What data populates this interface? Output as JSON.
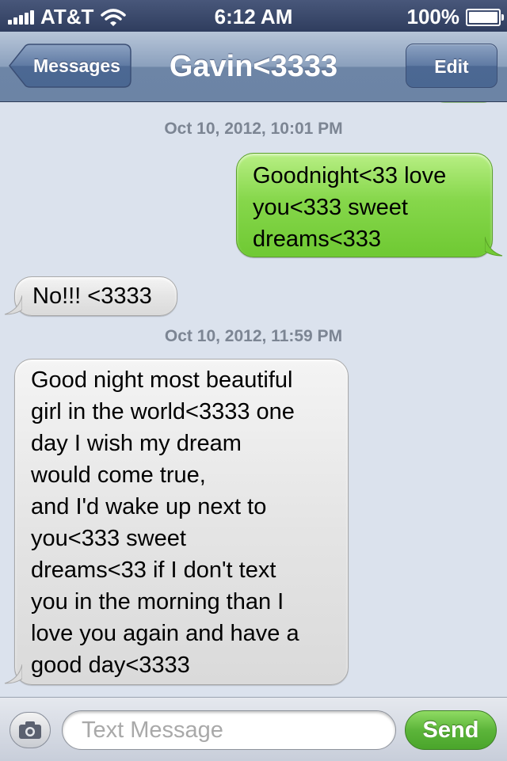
{
  "status_bar": {
    "carrier": "AT&T",
    "time": "6:12 AM",
    "battery": "100%"
  },
  "nav": {
    "back_label": "Messages",
    "title": "Gavin<3333",
    "edit_label": "Edit"
  },
  "messages": [
    {
      "type": "timestamp",
      "text": "Oct 10, 2012, 10:01 PM"
    },
    {
      "type": "outgoing",
      "text": "Goodnight<33 love\nyou<333 sweet\ndreams<333"
    },
    {
      "type": "incoming",
      "text": "No!!! <3333"
    },
    {
      "type": "timestamp",
      "text": "Oct 10, 2012, 11:59 PM"
    },
    {
      "type": "incoming",
      "text": "Good night most beautiful\ngirl in the world<3333 one\nday I wish my dream\nwould come true,\nand I'd wake up next to\nyou<333 sweet\ndreams<33 if I don't text\nyou in the morning than I\nlove you again and have a\ngood day<3333"
    }
  ],
  "input": {
    "placeholder": "Text Message",
    "send_label": "Send"
  },
  "colors": {
    "outgoing_bubble": "#86d74b",
    "incoming_bubble": "#e5e5e5",
    "chat_background": "#dbe2ed",
    "nav_bar": "#8ba0bd"
  }
}
